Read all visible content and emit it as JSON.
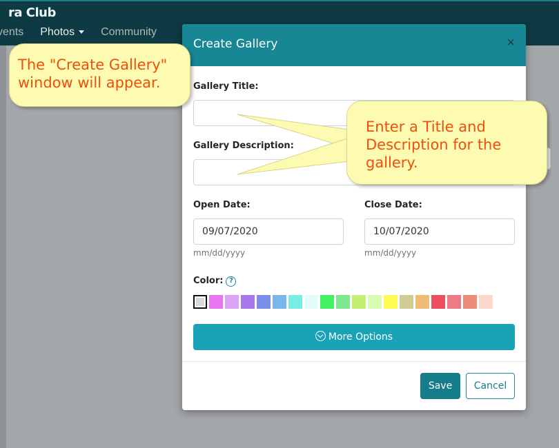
{
  "app": {
    "brand": "ra Club",
    "nav": [
      {
        "label": "vents"
      },
      {
        "label": "Photos"
      },
      {
        "label": "Community"
      }
    ]
  },
  "modal": {
    "title": "Create Gallery",
    "close_icon": "×",
    "gallery_title_label": "Gallery Title:",
    "gallery_title_value": "",
    "gallery_description_label": "Gallery Description:",
    "gallery_description_value": "",
    "open_date_label": "Open Date:",
    "open_date_value": "09/07/2020",
    "open_date_hint": "mm/dd/yyyy",
    "close_date_label": "Close Date:",
    "close_date_value": "10/07/2020",
    "close_date_hint": "mm/dd/yyyy",
    "color_label": "Color:",
    "help_icon": "?",
    "colors": [
      "#d9d9d9",
      "#e874f0",
      "#dba5f5",
      "#a779ec",
      "#7a8eea",
      "#79b6ec",
      "#79ece3",
      "#e4fbfc",
      "#45f263",
      "#7ee88f",
      "#c3f074",
      "#d9fbb5",
      "#fbfb53",
      "#cfcc93",
      "#efbc76",
      "#ec4f5f",
      "#ee7a86",
      "#ee8c79",
      "#fbd9cd"
    ],
    "selected_color": "#d9d9d9",
    "more_options_label": "More Options",
    "save_label": "Save",
    "cancel_label": "Cancel"
  },
  "callouts": [
    {
      "text_line1": "The \"Create Gallery\"",
      "text_line2": "window will appear."
    },
    {
      "text_line1": "Enter a Title and",
      "text_line2": "Description for the",
      "text_line3": "gallery."
    }
  ]
}
